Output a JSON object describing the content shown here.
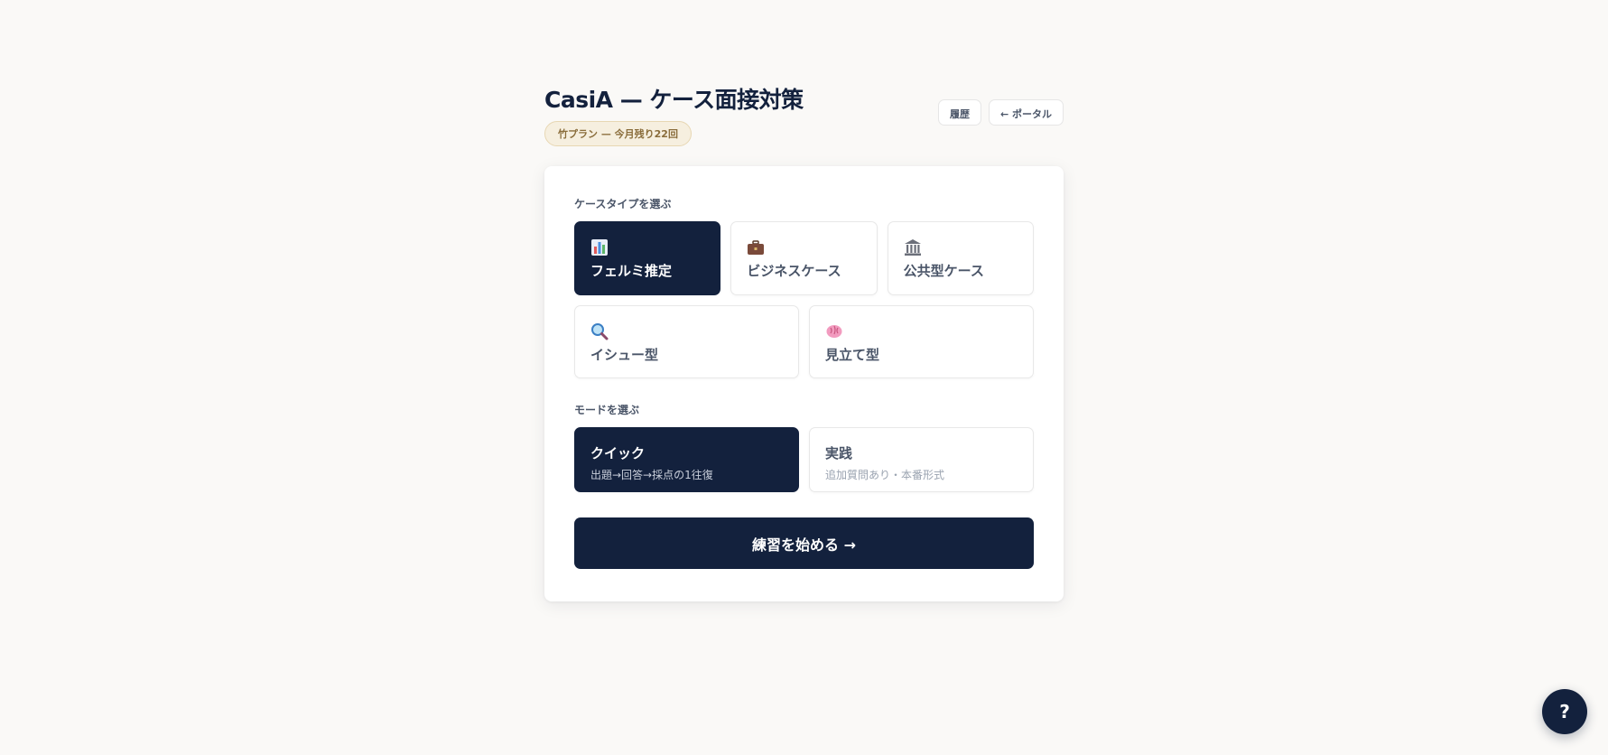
{
  "header": {
    "title": "CasiA — ケース面接対策",
    "plan_badge": "竹プラン — 今月残り22回",
    "history_button": "履歴",
    "portal_button": "← ポータル"
  },
  "case_type": {
    "label": "ケースタイプを選ぶ",
    "options": [
      {
        "label": "フェルミ推定",
        "icon": "bar-chart-icon",
        "selected": true
      },
      {
        "label": "ビジネスケース",
        "icon": "briefcase-icon",
        "selected": false
      },
      {
        "label": "公共型ケース",
        "icon": "classical-building-icon",
        "selected": false
      },
      {
        "label": "イシュー型",
        "icon": "magnifier-icon",
        "selected": false
      },
      {
        "label": "見立て型",
        "icon": "brain-icon",
        "selected": false
      }
    ]
  },
  "mode": {
    "label": "モードを選ぶ",
    "options": [
      {
        "title": "クイック",
        "description": "出題→回答→採点の1往復",
        "selected": true
      },
      {
        "title": "実践",
        "description": "追加質問あり・本番形式",
        "selected": false
      }
    ]
  },
  "start_button": "練習を始める →",
  "help_button": "?",
  "colors": {
    "primary": "#13213d",
    "background": "#faf9f7",
    "badge_bg": "#f6efdf",
    "badge_text": "#8a6d3b"
  }
}
